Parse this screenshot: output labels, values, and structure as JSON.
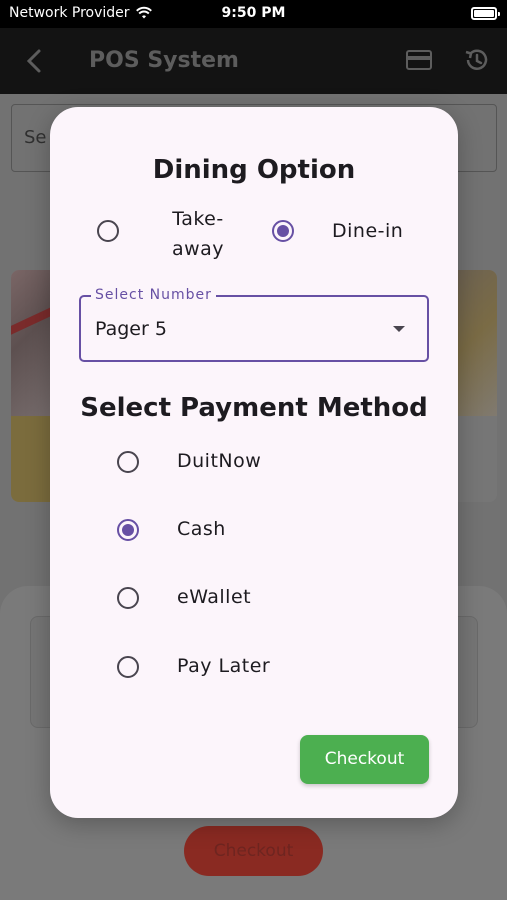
{
  "status_bar": {
    "carrier": "Network Provider",
    "time": "9:50 PM",
    "wifi_icon": "wifi-icon",
    "battery_icon": "battery-full-icon"
  },
  "app_bar": {
    "title": "POS System",
    "back_icon": "back-icon",
    "actions": [
      "credit-card-icon",
      "history-icon"
    ]
  },
  "background": {
    "search_label_partial": "Se",
    "checkout_label": "Checkout"
  },
  "dialog": {
    "dining_title": "Dining Option",
    "dining_options": [
      {
        "label": "Take-away",
        "selected": false
      },
      {
        "label": "Dine-in",
        "selected": true
      }
    ],
    "select_number": {
      "label": "Select  Number",
      "value": "Pager 5"
    },
    "payment_title": "Select Payment Method",
    "payment_methods": [
      {
        "label": "DuitNow",
        "selected": false
      },
      {
        "label": "Cash",
        "selected": true
      },
      {
        "label": "eWallet",
        "selected": false
      },
      {
        "label": "Pay Later",
        "selected": false
      }
    ],
    "checkout_label": "Checkout"
  },
  "colors": {
    "accent": "#6750a4",
    "checkout_green": "#4caf50",
    "dialog_background": "#fcf5fb"
  }
}
